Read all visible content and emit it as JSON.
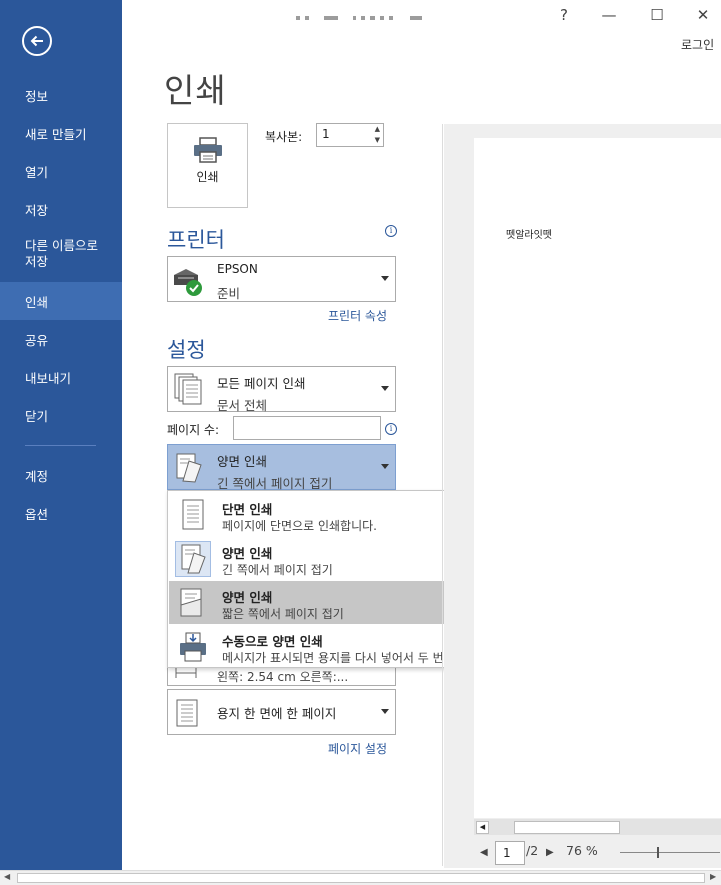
{
  "window": {
    "controls": {
      "help": "?",
      "minimize": "—",
      "maximize": "☐",
      "close": "✕"
    },
    "login_label": "로그인"
  },
  "sidebar": {
    "items": [
      {
        "label": "정보"
      },
      {
        "label": "새로 만들기"
      },
      {
        "label": "열기"
      },
      {
        "label": "저장"
      },
      {
        "label": "다른 이름으로\n저장"
      },
      {
        "label": "인쇄",
        "active": true
      },
      {
        "label": "공유"
      },
      {
        "label": "내보내기"
      },
      {
        "label": "닫기"
      },
      {
        "label": "계정"
      },
      {
        "label": "옵션"
      }
    ]
  },
  "print": {
    "title": "인쇄",
    "print_button_label": "인쇄",
    "copies_label": "복사본:",
    "copies_value": "1"
  },
  "printer": {
    "heading": "프린터",
    "name": "EPSON",
    "status": "준비",
    "properties_link": "프린터 속성"
  },
  "settings": {
    "heading": "설정",
    "print_range": {
      "title": "모든 페이지 인쇄",
      "subtitle": "문서 전체"
    },
    "pages_label": "페이지 수:",
    "pages_value": "",
    "duplex": {
      "title": "양면 인쇄",
      "subtitle": "긴 쪽에서 페이지 접기"
    },
    "margins_partial": "왼쪽: 2.54 cm    오른쪽:...",
    "pages_per_sheet": {
      "title": "용지 한 면에 한 페이지"
    },
    "page_setup_link": "페이지 설정"
  },
  "duplex_menu": {
    "options": [
      {
        "title": "단면 인쇄",
        "subtitle": "페이지에 단면으로 인쇄합니다."
      },
      {
        "title": "양면 인쇄",
        "subtitle": "긴 쪽에서 페이지 접기",
        "current": true
      },
      {
        "title": "양면 인쇄",
        "subtitle": "짧은 쪽에서 페이지 접기",
        "hovered": true
      },
      {
        "title": "수동으로 양면 인쇄",
        "subtitle": "메시지가 표시되면 용지를 다시 넣어서 두 번째 면을 인쇄합니다."
      }
    ]
  },
  "preview": {
    "page_text": "뗏알라잇뗏",
    "current_page": "1",
    "total_pages": "/2",
    "zoom": "76 %"
  },
  "colors": {
    "sidebar": "#2b579a",
    "sidebar_active": "#3e6db2",
    "accent": "#2b579a",
    "selected_dropdown": "#a7bedf",
    "menu_hover": "#c6c6c6"
  }
}
